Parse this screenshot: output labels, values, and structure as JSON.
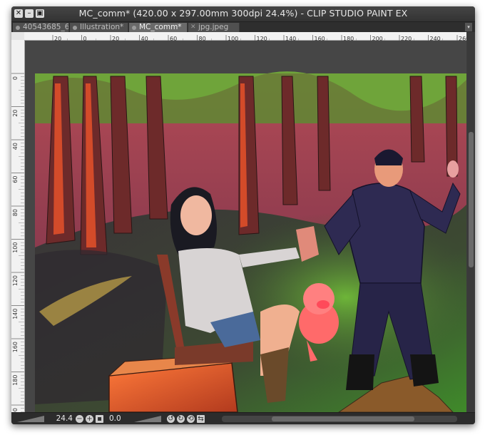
{
  "window": {
    "title": "MC_comm* (420.00 x 297.00mm 300dpi 24.4%)  - CLIP STUDIO PAINT EX",
    "close_glyph": "✕",
    "minimize_glyph": "–",
    "maximize_glyph": "▣"
  },
  "tabs": [
    {
      "label": "40543685_6"
    },
    {
      "label": "Illustration*"
    },
    {
      "label": "MC_comm*"
    },
    {
      "label": "jpg.jpeg"
    }
  ],
  "tab_scroll_glyph": "▾",
  "ruler": {
    "h_ticks": [
      "20",
      "0",
      "20",
      "40",
      "60",
      "80",
      "100",
      "120",
      "140",
      "160",
      "180",
      "200",
      "220",
      "240",
      "260"
    ],
    "v_ticks": [
      "0",
      "20",
      "40",
      "60",
      "80",
      "100",
      "120",
      "140",
      "160",
      "180",
      "200"
    ]
  },
  "status": {
    "zoom": "24.4",
    "rotation": "0.0"
  },
  "icons": {
    "zoom_out": "zoom-out-icon",
    "zoom_in": "zoom-in-icon",
    "fit": "fit-window-icon",
    "rotate_left": "rotate-left-icon",
    "rotate_right": "rotate-right-icon",
    "reset_rotation": "reset-rotation-icon",
    "flip": "flip-icon"
  }
}
